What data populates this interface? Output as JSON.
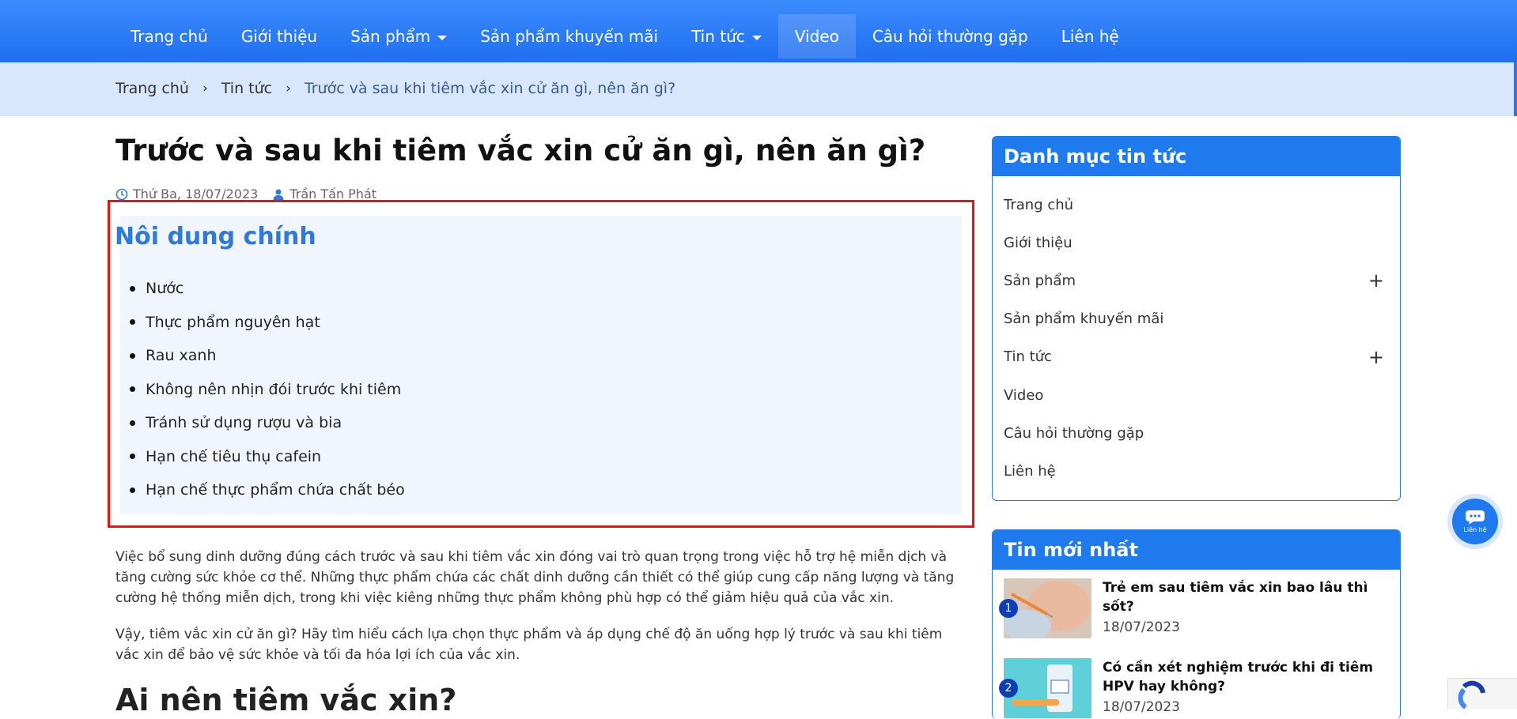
{
  "nav": {
    "items": [
      {
        "label": "Trang chủ",
        "dropdown": false
      },
      {
        "label": "Giới thiệu",
        "dropdown": false
      },
      {
        "label": "Sản phẩm",
        "dropdown": true
      },
      {
        "label": "Sản phẩm khuyến mãi",
        "dropdown": false
      },
      {
        "label": "Tin tức",
        "dropdown": true
      },
      {
        "label": "Video",
        "dropdown": false,
        "active": true
      },
      {
        "label": "Câu hỏi thường gặp",
        "dropdown": false
      },
      {
        "label": "Liên hệ",
        "dropdown": false
      }
    ]
  },
  "breadcrumb": {
    "home": "Trang chủ",
    "section": "Tin tức",
    "current": "Trước và sau khi tiêm vắc xin cử ăn gì, nên ăn gì?"
  },
  "article": {
    "title": "Trước và sau khi tiêm vắc xin cử ăn gì, nên ăn gì?",
    "date": "Thứ Ba, 18/07/2023",
    "author": "Trần Tấn Phát",
    "toc": {
      "title": "Nôi dung chính",
      "items": [
        "Nước",
        "Thực phẩm nguyên hạt",
        "Rau xanh",
        "Không nên nhịn đói trước khi tiêm",
        "Tránh sử dụng rượu và bia",
        "Hạn chế tiêu thụ cafein",
        "Hạn chế thực phẩm chứa chất béo"
      ]
    },
    "paragraph1": "Việc bổ sung dinh dưỡng đúng cách trước và sau khi tiêm vắc xin đóng vai trò quan trọng trong việc hỗ trợ hệ miễn dịch và tăng cường sức khỏe cơ thể. Những thực phẩm chứa các chất dinh dưỡng cần thiết có thể giúp cung cấp năng lượng và tăng cường hệ thống miễn dịch, trong khi việc kiêng những thực phẩm không phù hợp có thể giảm hiệu quả của vắc xin.",
    "paragraph2": "Vậy, tiêm vắc xin cử ăn gì? Hãy tìm hiểu cách lựa chọn thực phẩm và áp dụng chế độ ăn uống hợp lý trước và sau khi tiêm vắc xin để bảo vệ sức khỏe và tối đa hóa lợi ích của vắc xin.",
    "heading2": "Ai nên tiêm vắc xin?"
  },
  "sidebar": {
    "categories": {
      "title": "Danh mục tin tức",
      "items": [
        {
          "label": "Trang chủ",
          "expandable": false
        },
        {
          "label": "Giới thiệu",
          "expandable": false
        },
        {
          "label": "Sản phẩm",
          "expandable": true
        },
        {
          "label": "Sản phẩm khuyến mãi",
          "expandable": false
        },
        {
          "label": "Tin tức",
          "expandable": true
        },
        {
          "label": "Video",
          "expandable": false
        },
        {
          "label": "Câu hỏi thường gặp",
          "expandable": false
        },
        {
          "label": "Liên hệ",
          "expandable": false
        }
      ]
    },
    "latest": {
      "title": "Tin mới nhất",
      "items": [
        {
          "num": "1",
          "title": "Trẻ em sau tiêm vắc xin bao lâu thì sốt?",
          "date": "18/07/2023"
        },
        {
          "num": "2",
          "title": "Có cần xét nghiệm trước khi đi tiêm HPV hay không?",
          "date": "18/07/2023"
        }
      ]
    }
  },
  "chat": {
    "label": "Liên hệ",
    "icon": "chat-icon"
  },
  "colors": {
    "nav": "#1f6ff0",
    "accent": "#2f7ad9",
    "highlight_border": "#e11111",
    "toc_bg": "#f1f6fe"
  }
}
